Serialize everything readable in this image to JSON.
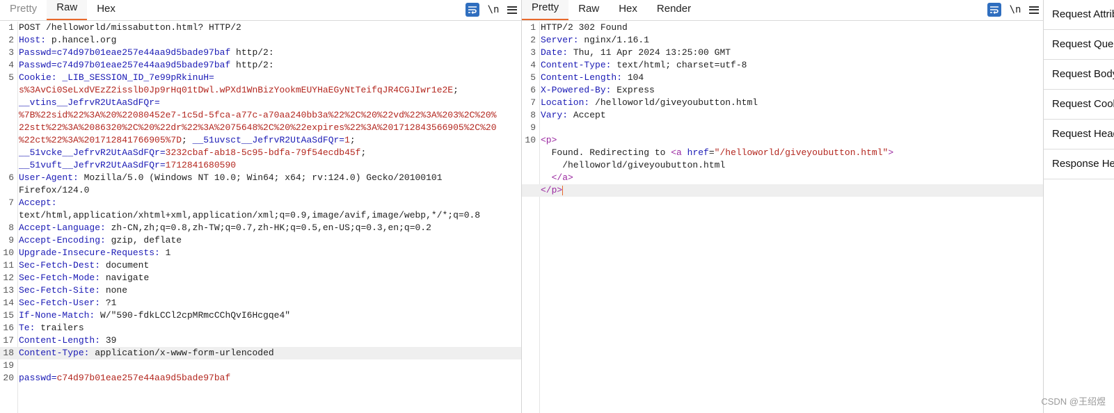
{
  "request": {
    "tabs": [
      "Pretty",
      "Raw",
      "Hex"
    ],
    "active_tab": "Raw",
    "tools": {
      "wrap_icon": "wrap-lines-icon",
      "newline_label": "\\n",
      "menu_icon": "menu-icon"
    },
    "lines": [
      {
        "n": "1",
        "segs": [
          {
            "c": "v",
            "t": "POST /helloworld/missabutton.html? HTTP/2"
          }
        ]
      },
      {
        "n": "2",
        "segs": [
          {
            "c": "k",
            "t": "Host:"
          },
          {
            "c": "v",
            "t": " p.hancel.org"
          }
        ]
      },
      {
        "n": "3",
        "segs": [
          {
            "c": "k",
            "t": "Passwd=c74d97b01eae257e44aa9d5bade97baf"
          },
          {
            "c": "v",
            "t": " http/2:"
          }
        ]
      },
      {
        "n": "4",
        "segs": [
          {
            "c": "k",
            "t": "Passwd=c74d97b01eae257e44aa9d5bade97baf"
          },
          {
            "c": "v",
            "t": " http/2:"
          }
        ]
      },
      {
        "n": "5",
        "segs": [
          {
            "c": "k",
            "t": "Cookie: _LIB_SESSION_ID_7e99pRkinuH="
          }
        ]
      },
      {
        "n": "",
        "segs": [
          {
            "c": "r",
            "t": "s%3AvCi0SeLxdVEzZ2isslb0Jp9rHq01tDwl.wPXd1WnBizYookmEUYHaEGyNtTeifqJR4CGJIwr1e2E"
          },
          {
            "c": "v",
            "t": ";"
          }
        ]
      },
      {
        "n": "",
        "segs": [
          {
            "c": "k",
            "t": "__vtins__JefrvR2UtAaSdFQr="
          }
        ]
      },
      {
        "n": "",
        "segs": [
          {
            "c": "r",
            "t": "%7B%22sid%22%3A%20%22080452e7-1c5d-5fca-a77c-a70aa240bb3a%22%2C%20%22vd%22%3A%203%2C%20%"
          }
        ]
      },
      {
        "n": "",
        "segs": [
          {
            "c": "r",
            "t": "22stt%22%3A%2086320%2C%20%22dr%22%3A%2075648%2C%20%22expires%22%3A%201712843566905%2C%20"
          }
        ]
      },
      {
        "n": "",
        "segs": [
          {
            "c": "r",
            "t": "%22ct%22%3A%201712841766905%7D"
          },
          {
            "c": "v",
            "t": "; "
          },
          {
            "c": "k",
            "t": "__51uvsct__JefrvR2UtAaSdFQr="
          },
          {
            "c": "r",
            "t": "1"
          },
          {
            "c": "v",
            "t": ";"
          }
        ]
      },
      {
        "n": "",
        "segs": [
          {
            "c": "k",
            "t": "__51vcke__JefrvR2UtAaSdFQr="
          },
          {
            "c": "r",
            "t": "3232cbaf-ab18-5c95-bdfa-79f54ecdb45f"
          },
          {
            "c": "v",
            "t": ";"
          }
        ]
      },
      {
        "n": "",
        "segs": [
          {
            "c": "k",
            "t": "__51vuft__JefrvR2UtAaSdFQr="
          },
          {
            "c": "r",
            "t": "1712841680590"
          }
        ]
      },
      {
        "n": "6",
        "segs": [
          {
            "c": "k",
            "t": "User-Agent:"
          },
          {
            "c": "v",
            "t": " Mozilla/5.0 (Windows NT 10.0; Win64; x64; rv:124.0) Gecko/20100101"
          }
        ]
      },
      {
        "n": "",
        "segs": [
          {
            "c": "v",
            "t": "Firefox/124.0"
          }
        ]
      },
      {
        "n": "7",
        "segs": [
          {
            "c": "k",
            "t": "Accept:"
          }
        ]
      },
      {
        "n": "",
        "segs": [
          {
            "c": "v",
            "t": "text/html,application/xhtml+xml,application/xml;q=0.9,image/avif,image/webp,*/*;q=0.8"
          }
        ]
      },
      {
        "n": "8",
        "segs": [
          {
            "c": "k",
            "t": "Accept-Language:"
          },
          {
            "c": "v",
            "t": " zh-CN,zh;q=0.8,zh-TW;q=0.7,zh-HK;q=0.5,en-US;q=0.3,en;q=0.2"
          }
        ]
      },
      {
        "n": "9",
        "segs": [
          {
            "c": "k",
            "t": "Accept-Encoding:"
          },
          {
            "c": "v",
            "t": " gzip, deflate"
          }
        ]
      },
      {
        "n": "10",
        "segs": [
          {
            "c": "k",
            "t": "Upgrade-Insecure-Requests:"
          },
          {
            "c": "v",
            "t": " 1"
          }
        ]
      },
      {
        "n": "11",
        "segs": [
          {
            "c": "k",
            "t": "Sec-Fetch-Dest:"
          },
          {
            "c": "v",
            "t": " document"
          }
        ]
      },
      {
        "n": "12",
        "segs": [
          {
            "c": "k",
            "t": "Sec-Fetch-Mode:"
          },
          {
            "c": "v",
            "t": " navigate"
          }
        ]
      },
      {
        "n": "13",
        "segs": [
          {
            "c": "k",
            "t": "Sec-Fetch-Site:"
          },
          {
            "c": "v",
            "t": " none"
          }
        ]
      },
      {
        "n": "14",
        "segs": [
          {
            "c": "k",
            "t": "Sec-Fetch-User:"
          },
          {
            "c": "v",
            "t": " ?1"
          }
        ]
      },
      {
        "n": "15",
        "segs": [
          {
            "c": "k",
            "t": "If-None-Match:"
          },
          {
            "c": "v",
            "t": " W/\"590-fdkLCCl2cpMRmcCChQvI6Hcgqe4\""
          }
        ]
      },
      {
        "n": "16",
        "segs": [
          {
            "c": "k",
            "t": "Te:"
          },
          {
            "c": "v",
            "t": " trailers"
          }
        ]
      },
      {
        "n": "17",
        "segs": [
          {
            "c": "k",
            "t": "Content-Length:"
          },
          {
            "c": "v",
            "t": " 39"
          }
        ]
      },
      {
        "n": "18",
        "hl": true,
        "segs": [
          {
            "c": "k",
            "t": "Content-Type:"
          },
          {
            "c": "v",
            "t": " application/x-www-form-urlencoded"
          }
        ]
      },
      {
        "n": "19",
        "segs": []
      },
      {
        "n": "20",
        "segs": [
          {
            "c": "k",
            "t": "passwd="
          },
          {
            "c": "r",
            "t": "c74d97b01eae257e44aa9d5bade97baf"
          }
        ]
      }
    ]
  },
  "response": {
    "tabs": [
      "Pretty",
      "Raw",
      "Hex",
      "Render"
    ],
    "active_tab": "Pretty",
    "tools": {
      "wrap_icon": "wrap-lines-icon",
      "newline_label": "\\n",
      "menu_icon": "menu-icon"
    },
    "lines": [
      {
        "n": "1",
        "segs": [
          {
            "c": "v",
            "t": "HTTP/2 302 Found"
          }
        ]
      },
      {
        "n": "2",
        "segs": [
          {
            "c": "k",
            "t": "Server:"
          },
          {
            "c": "v",
            "t": " nginx/1.16.1"
          }
        ]
      },
      {
        "n": "3",
        "segs": [
          {
            "c": "k",
            "t": "Date:"
          },
          {
            "c": "v",
            "t": " Thu, 11 Apr 2024 13:25:00 GMT"
          }
        ]
      },
      {
        "n": "4",
        "segs": [
          {
            "c": "k",
            "t": "Content-Type:"
          },
          {
            "c": "v",
            "t": " text/html; charset=utf-8"
          }
        ]
      },
      {
        "n": "5",
        "segs": [
          {
            "c": "k",
            "t": "Content-Length:"
          },
          {
            "c": "v",
            "t": " 104"
          }
        ]
      },
      {
        "n": "6",
        "segs": [
          {
            "c": "k",
            "t": "X-Powered-By:"
          },
          {
            "c": "v",
            "t": " Express"
          }
        ]
      },
      {
        "n": "7",
        "segs": [
          {
            "c": "k",
            "t": "Location:"
          },
          {
            "c": "v",
            "t": " /helloworld/giveyoubutton.html"
          }
        ]
      },
      {
        "n": "8",
        "segs": [
          {
            "c": "k",
            "t": "Vary:"
          },
          {
            "c": "v",
            "t": " Accept"
          }
        ]
      },
      {
        "n": "9",
        "segs": []
      },
      {
        "n": "10",
        "segs": [
          {
            "c": "tag",
            "t": "<p>"
          }
        ]
      },
      {
        "n": "",
        "segs": [
          {
            "c": "v",
            "t": "  Found. Redirecting to "
          },
          {
            "c": "tag",
            "t": "<a "
          },
          {
            "c": "attr",
            "t": "href"
          },
          {
            "c": "v",
            "t": "="
          },
          {
            "c": "str",
            "t": "\"/helloworld/giveyoubutton.html\""
          },
          {
            "c": "tag",
            "t": ">"
          }
        ]
      },
      {
        "n": "",
        "segs": [
          {
            "c": "v",
            "t": "    /helloworld/giveyoubutton.html"
          }
        ]
      },
      {
        "n": "",
        "segs": [
          {
            "c": "tag",
            "t": "  </a>"
          }
        ]
      },
      {
        "n": "",
        "hl": true,
        "cursor": true,
        "segs": [
          {
            "c": "tag",
            "t": "</p>"
          }
        ]
      }
    ]
  },
  "inspector": {
    "items": [
      "Request Attributes",
      "Request Query Parameters",
      "Request Body Parameters",
      "Request Cookies",
      "Request Headers",
      "Response Headers"
    ]
  },
  "watermark": "CSDN @王绍煜"
}
